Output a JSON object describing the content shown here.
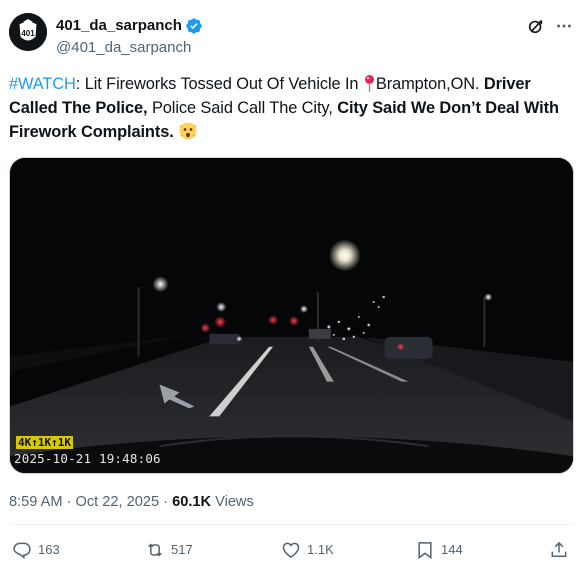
{
  "user": {
    "display_name": "401_da_sarpanch",
    "handle": "@401_da_sarpanch",
    "avatar_text": "401",
    "verified": true
  },
  "tweet": {
    "hashtag": "#WATCH",
    "part1": ": Lit Fireworks Tossed Out Of Vehicle In ",
    "location": "Brampton,ON. ",
    "bold1": "Driver Called The Police,",
    "part2": " Police Said Call The City, ",
    "bold2": "City Said We Don’t Deal With Firework Complaints.",
    "emoji_name": "astonished-face-emoji"
  },
  "media": {
    "badge": "4K↑1K↑1K",
    "timestamp": "2025-10-21  19:48:06"
  },
  "meta": {
    "time": "8:59 AM",
    "separator": " · ",
    "date": "Oct 22, 2025",
    "views_count": "60.1K",
    "views_label": " Views"
  },
  "actions": {
    "replies": "163",
    "reposts": "517",
    "likes": "1.1K",
    "bookmarks": "144"
  },
  "colors": {
    "accent": "#1d9bf0",
    "text": "#0f1419",
    "muted": "#536471"
  },
  "icons": [
    "verified-badge-icon",
    "grok-icon",
    "more-icon",
    "location-pin-icon",
    "reply-icon",
    "repost-icon",
    "like-icon",
    "bookmark-icon",
    "share-icon"
  ]
}
